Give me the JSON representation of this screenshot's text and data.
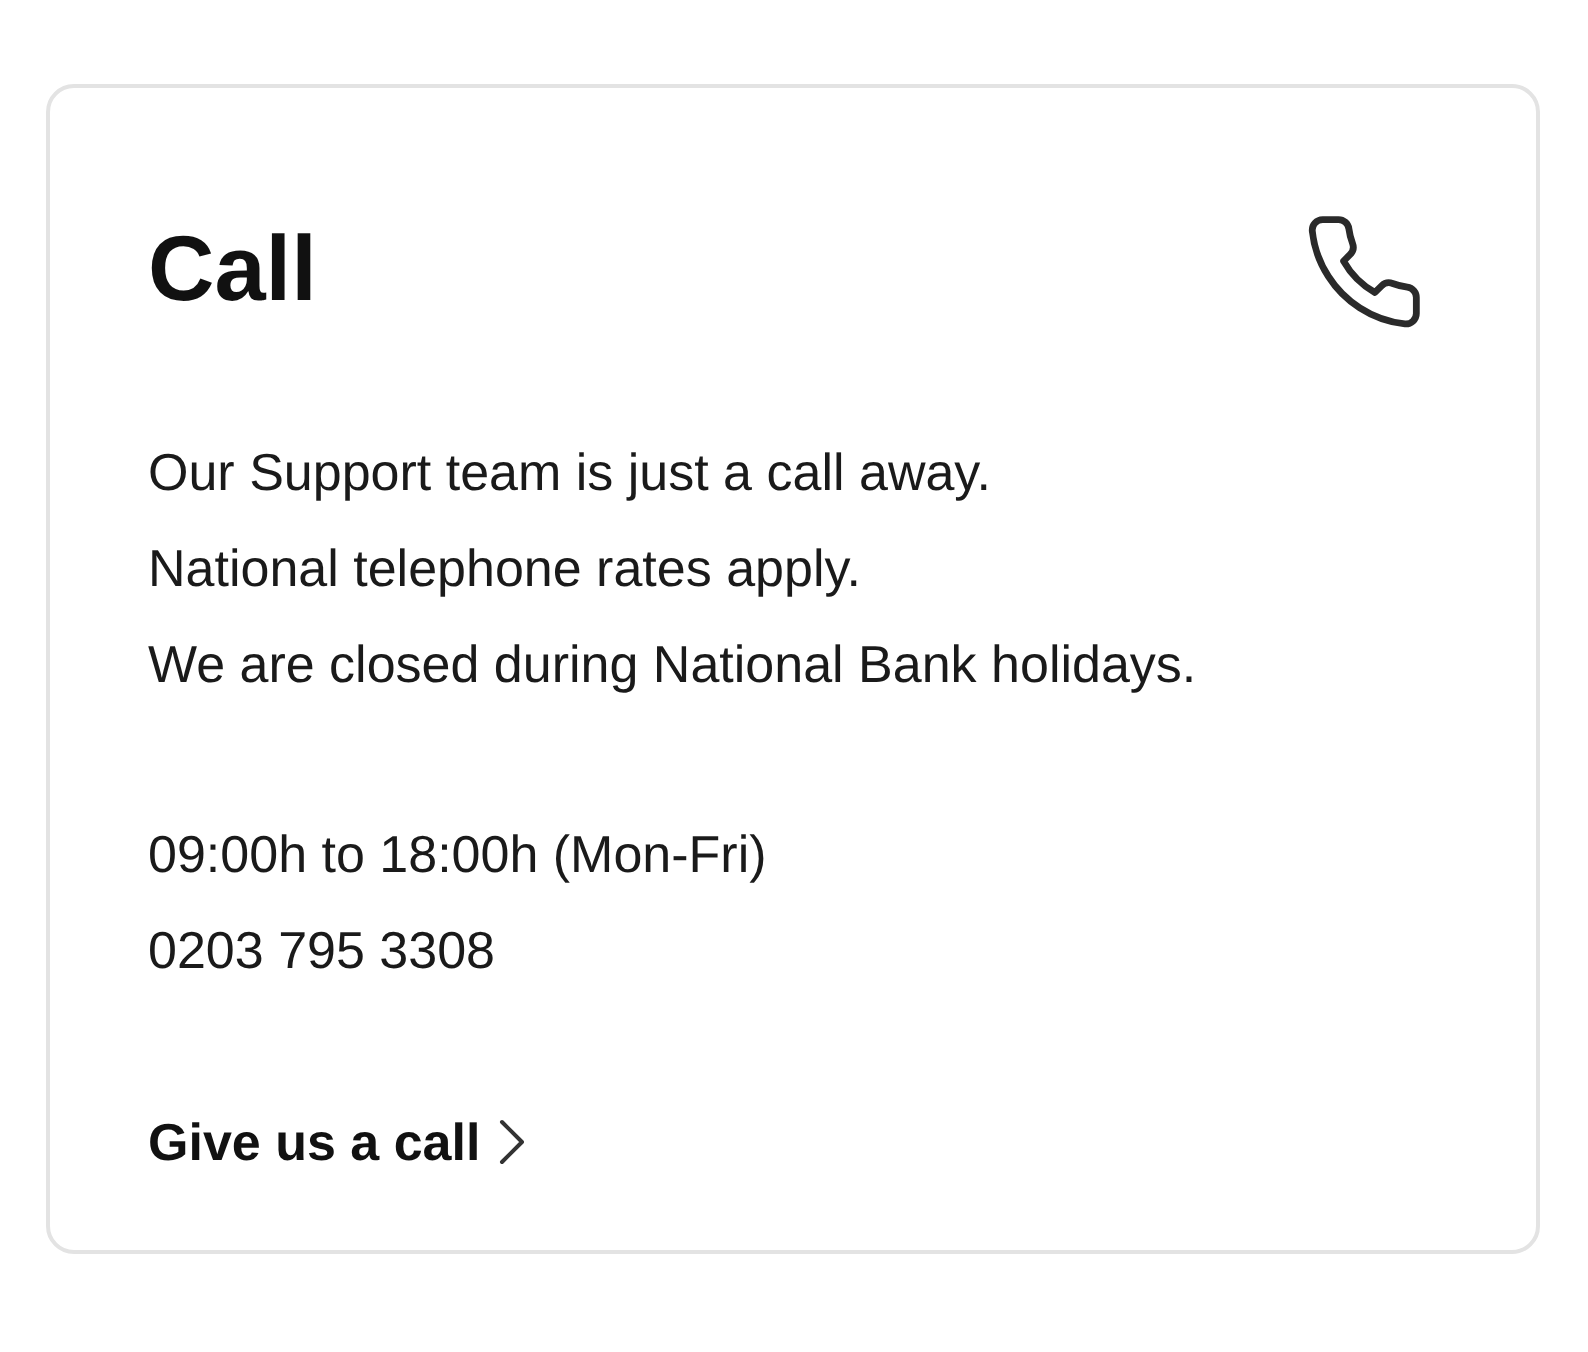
{
  "card": {
    "title": "Call",
    "description": [
      "Our Support team is just a call away.",
      "National telephone rates apply.",
      "We are closed during National Bank holidays."
    ],
    "hours": "09:00h to 18:00h (Mon-Fri)",
    "phone": "0203 795 3308",
    "link": {
      "label": "Give us a call"
    }
  }
}
